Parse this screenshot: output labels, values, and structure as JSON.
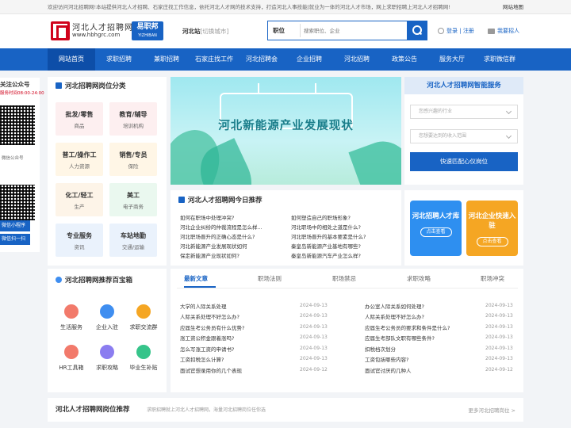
{
  "topbar": {
    "notice": "欢迎访问河北招聘网!本站提供河北人才招聘、石家庄找工作信息，依托河北人才网的技术支持，打造河北人事技能|就业为一体的河北人才市场，网上求职招聘上河北人才招聘网!",
    "sitemap": "网站地图"
  },
  "header": {
    "logo_name": "河北人才招聘网",
    "logo_url": "www.hbhgrc.com",
    "partner": "易职邦",
    "partner_sub": "YIZHIBAN",
    "city": "河北站",
    "city_switch": "[切换城市]",
    "search_type": "职位",
    "search_placeholder": "搜索职位、企业",
    "login": "登录",
    "register": "注册",
    "recruit": "我要招人"
  },
  "nav": [
    "网站首页",
    "求职招聘",
    "兼职招聘",
    "石家庄找工作",
    "河北招聘会",
    "企业招聘",
    "河北招聘",
    "政策公告",
    "服务大厅",
    "求职微信群"
  ],
  "follow": {
    "title": "关注公众号",
    "hours": "服务时间08:00-24:00",
    "qr1_caption": "微信公众号",
    "btn1": "微信小程序",
    "btn2": "微信扫一扫"
  },
  "categories": {
    "title": "河北招聘网岗位分类",
    "items": [
      {
        "name": "批发/零售",
        "sub": "商品",
        "color": "#fdeff0"
      },
      {
        "name": "教育/辅导",
        "sub": "培训机构",
        "color": "#fdeff0"
      },
      {
        "name": "普工/操作工",
        "sub": "人力资源",
        "color": "#fff6e6"
      },
      {
        "name": "销售/专员",
        "sub": "保险",
        "color": "#fff6e6"
      },
      {
        "name": "化工/轻工",
        "sub": "生产",
        "color": "#fdf4e8"
      },
      {
        "name": "美工",
        "sub": "电子商务",
        "color": "#eaf8ef"
      },
      {
        "name": "专业服务",
        "sub": "资讯",
        "color": "#eaf2fc"
      },
      {
        "name": "车站地勤",
        "sub": "交通/运输",
        "color": "#eaf2fc"
      }
    ]
  },
  "banner": {
    "text": "河北新能源产业发展现状"
  },
  "smart": {
    "title": "河北人才招聘网智能服务",
    "industry": "您感兴趣的行业",
    "income": "您想要达到的收入范围",
    "button": "快速匹配心仪岗位"
  },
  "today": {
    "title": "河北人才招聘网今日推荐",
    "left": [
      "如何在职场中处理冲突?",
      "河北企业纠纷的仲裁流程是怎么样...",
      "河北职场晋升的正确心态是什么?",
      "河北新能源产业发展现状如何",
      "保定新能源产业现状如何?"
    ],
    "right": [
      "如何塑造自己的职场形象?",
      "河北职场中的相处之道是什么?",
      "河北职场晋升的基本要素是什么?",
      "秦皇岛新能源产业基地有哪些?",
      "秦皇岛新能源汽车产业怎么样?"
    ]
  },
  "cards": [
    {
      "name": "河北招聘人才库",
      "button": "点击查看",
      "color": "#2e8ff0"
    },
    {
      "name": "河北企业快速入驻",
      "button": "点击查看",
      "color": "#f5a623"
    }
  ],
  "toolbox": {
    "title": "河北招聘网推荐百宝箱",
    "items": [
      {
        "label": "生活服务",
        "color": "#f27a6b"
      },
      {
        "label": "企业入驻",
        "color": "#3f8ef0"
      },
      {
        "label": "求职交流群",
        "color": "#f5a623"
      },
      {
        "label": "HR工具箱",
        "color": "#f27a6b"
      },
      {
        "label": "求职攻略",
        "color": "#8b7df0"
      },
      {
        "label": "毕业生补贴",
        "color": "#36c48a"
      }
    ]
  },
  "news": {
    "tabs": [
      "最新文章",
      "职场法则",
      "职场禁忌",
      "求职攻略",
      "职场冲突"
    ],
    "left": [
      {
        "title": "大学的人际关系处理",
        "date": "2024-09-13"
      },
      {
        "title": "人际关系处理不好怎么办?",
        "date": "2024-09-13"
      },
      {
        "title": "应届生考公务员有什么优势?",
        "date": "2024-09-13"
      },
      {
        "title": "涨工资公积金跟着涨吗?",
        "date": "2024-09-13"
      },
      {
        "title": "怎么写涨工资的申请书?",
        "date": "2024-09-13"
      },
      {
        "title": "工资扣税怎么计算?",
        "date": "2024-09-13"
      },
      {
        "title": "面试官想录用你的几个表现",
        "date": "2024-09-12"
      }
    ],
    "right": [
      {
        "title": "办公室人际关系如何处理?",
        "date": "2024-09-13"
      },
      {
        "title": "人际关系处理不好怎么办?",
        "date": "2024-09-13"
      },
      {
        "title": "应届生考公务员的要求和条件是什么?",
        "date": "2024-09-13"
      },
      {
        "title": "应届生考部队文职有哪些条件?",
        "date": "2024-09-13"
      },
      {
        "title": "扣税档次划分",
        "date": "2024-09-13"
      },
      {
        "title": "工资包括哪些内容?",
        "date": "2024-09-13"
      },
      {
        "title": "面试官讨厌的几种人",
        "date": "2024-09-12"
      }
    ]
  },
  "bottom": {
    "title": "河北人才招聘网岗位推荐",
    "desc": "求职招聘就上河北人才招聘网，海量河北招聘岗位任你选",
    "more": "更多河北招聘岗位 >"
  }
}
